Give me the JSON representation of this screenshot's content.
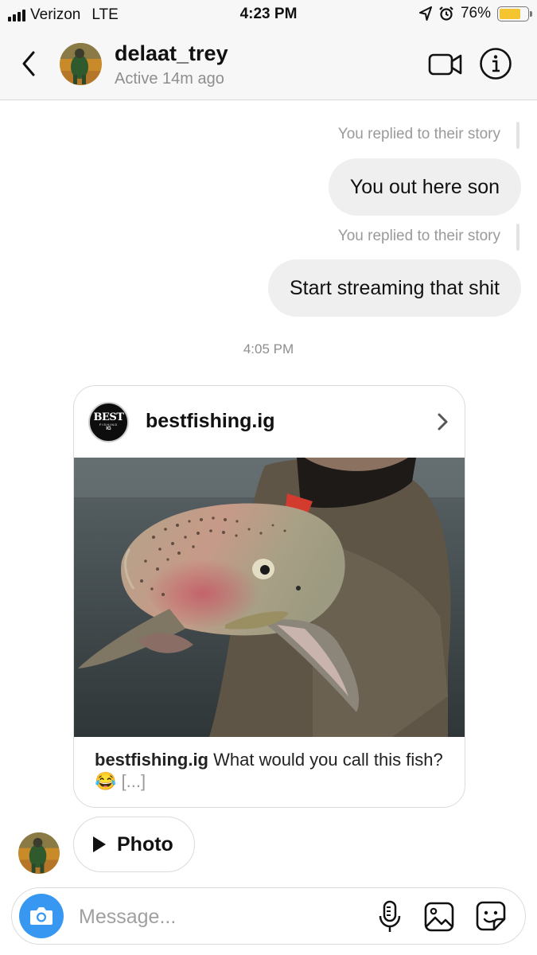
{
  "status_bar": {
    "carrier": "Verizon",
    "network": "LTE",
    "time": "4:23 PM",
    "battery_text": "76%",
    "battery_level": 0.76,
    "battery_color": "#f4c431"
  },
  "header": {
    "username": "delaat_trey",
    "active_status": "Active 14m ago",
    "icons": [
      "back-arrow-icon",
      "video-call-icon",
      "info-icon"
    ]
  },
  "messages": [
    {
      "note": "You replied to their story",
      "text": "You out here son"
    },
    {
      "note": "You replied to their story",
      "text": "Start streaming that shit"
    }
  ],
  "timestamp": "4:05 PM",
  "shared_post": {
    "logo_text": {
      "line1": "BEST",
      "line2": "FISHING",
      "line3": "IG"
    },
    "account": "bestfishing.ig",
    "caption_account": "bestfishing.ig",
    "caption_text": " What would you call this fish? 😂 ",
    "caption_more": "[...]"
  },
  "photo_message": {
    "label": "Photo"
  },
  "composer": {
    "placeholder": "Message...",
    "accent_color": "#3897f0",
    "icons": [
      "camera-icon",
      "microphone-icon",
      "gallery-icon",
      "sticker-icon"
    ]
  }
}
